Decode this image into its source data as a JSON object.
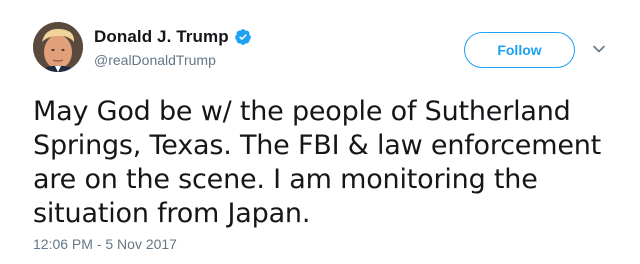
{
  "author": {
    "display_name": "Donald J. Trump",
    "handle": "@realDonaldTrump",
    "verified": true
  },
  "actions": {
    "follow_label": "Follow"
  },
  "tweet": {
    "text": "May God be w/ the people of Sutherland Springs, Texas. The FBI & law enforcement are on the scene. I am monitoring the situation from Japan.",
    "timestamp": "12:06 PM - 5 Nov 2017"
  },
  "icons": {
    "verified": "verified-badge-icon",
    "more": "chevron-down-icon"
  },
  "colors": {
    "accent": "#1da1f2",
    "text": "#14171a",
    "muted": "#657786"
  }
}
